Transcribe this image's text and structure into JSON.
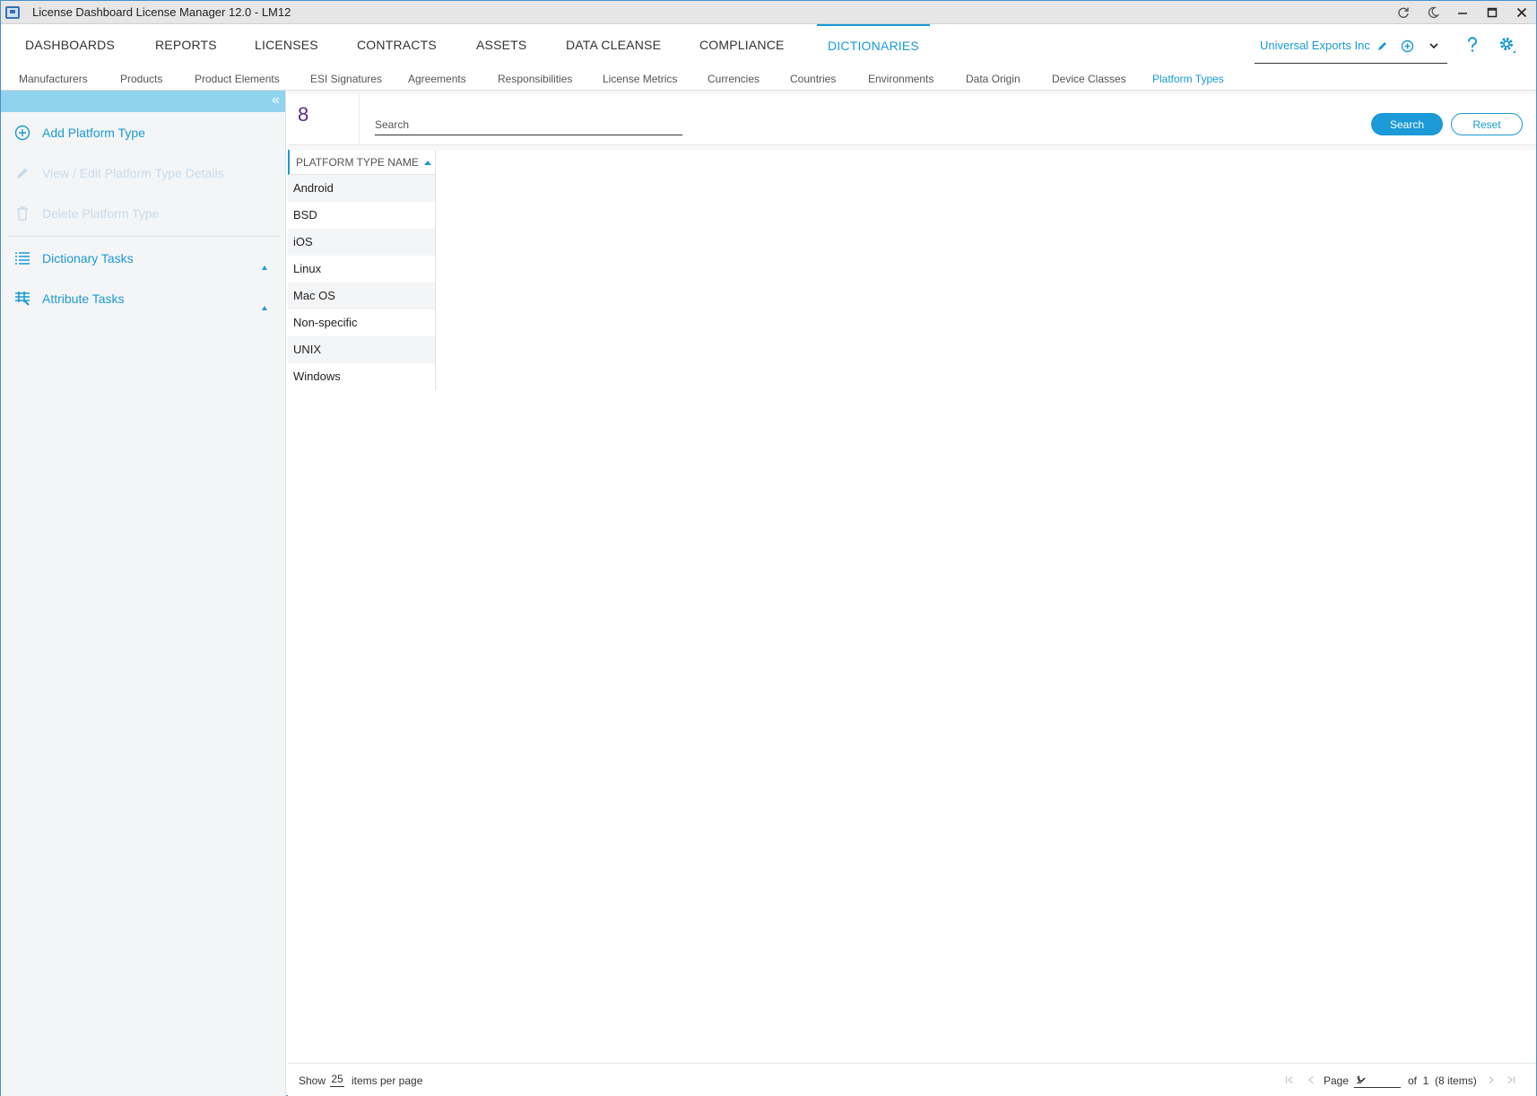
{
  "window": {
    "title": "License Dashboard License Manager 12.0 - LM12"
  },
  "main_nav": {
    "items": [
      "DASHBOARDS",
      "REPORTS",
      "LICENSES",
      "CONTRACTS",
      "ASSETS",
      "DATA CLEANSE",
      "COMPLIANCE",
      "DICTIONARIES"
    ],
    "active": "DICTIONARIES"
  },
  "company": {
    "name": "Universal Exports Inc"
  },
  "sub_nav": {
    "items": [
      "Manufacturers",
      "Products",
      "Product Elements",
      "ESI Signatures",
      "Agreements",
      "Responsibilities",
      "License Metrics",
      "Currencies",
      "Countries",
      "Environments",
      "Data Origin",
      "Device Classes",
      "Platform Types"
    ],
    "active": "Platform Types"
  },
  "sidebar": {
    "tasks": [
      {
        "label": "Add Platform Type",
        "icon": "add-circle-icon",
        "enabled": true
      },
      {
        "label": "View / Edit Platform Type Details",
        "icon": "pencil-icon",
        "enabled": false
      },
      {
        "label": "Delete Platform Type",
        "icon": "trash-icon",
        "enabled": false
      }
    ],
    "groups": [
      {
        "label": "Dictionary Tasks",
        "icon": "list-icon"
      },
      {
        "label": "Attribute Tasks",
        "icon": "attribute-icon"
      }
    ]
  },
  "search": {
    "count": "8",
    "placeholder": "Search",
    "value": "",
    "search_label": "Search",
    "reset_label": "Reset"
  },
  "grid": {
    "column_header": "PLATFORM TYPE NAME",
    "sort": "ascending",
    "rows": [
      "Android",
      "BSD",
      "iOS",
      "Linux",
      "Mac OS",
      "Non-specific",
      "UNIX",
      "Windows"
    ]
  },
  "pager": {
    "show_label": "Show",
    "page_size": "25",
    "items_per_page_label": "items per page",
    "page_label": "Page",
    "current_page": "1",
    "of_label": "of  1  (8 items)"
  },
  "colors": {
    "accent": "#1a9ad6",
    "sidebar_header": "#8fd3ee",
    "count": "#5a2a8c"
  }
}
